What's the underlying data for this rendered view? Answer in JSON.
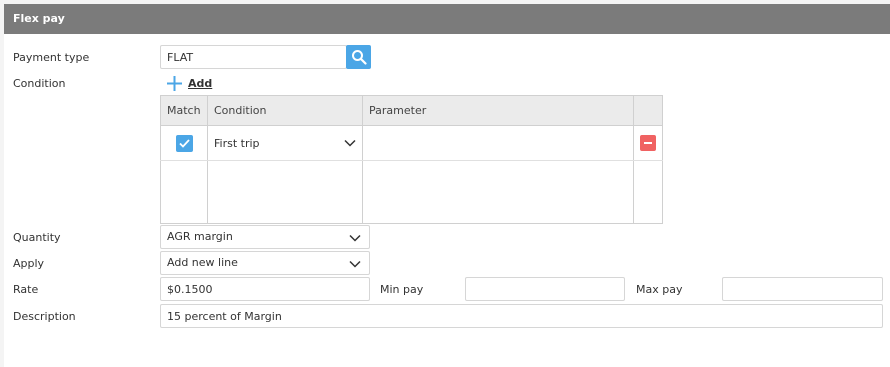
{
  "header": {
    "title": "Flex pay"
  },
  "form": {
    "payment_type": {
      "label": "Payment type",
      "value": "FLAT"
    },
    "condition": {
      "label": "Condition",
      "add_label": "Add",
      "columns": [
        "Match",
        "Condition",
        "Parameter",
        ""
      ],
      "rows": [
        {
          "match": true,
          "condition": "First trip",
          "parameter": ""
        }
      ]
    },
    "quantity": {
      "label": "Quantity",
      "value": "AGR margin"
    },
    "apply": {
      "label": "Apply",
      "value": "Add new line"
    },
    "rate": {
      "label": "Rate",
      "value": "$0.1500"
    },
    "min_pay": {
      "label": "Min pay",
      "value": ""
    },
    "max_pay": {
      "label": "Max pay",
      "value": ""
    },
    "description": {
      "label": "Description",
      "value": "15 percent of Margin"
    }
  },
  "colors": {
    "header_bg": "#7b7b7b",
    "accent": "#4ba6e6",
    "danger": "#f06262"
  },
  "icons": [
    "search-icon",
    "plus-icon",
    "check-icon",
    "chevron-down-icon",
    "minus-icon"
  ]
}
